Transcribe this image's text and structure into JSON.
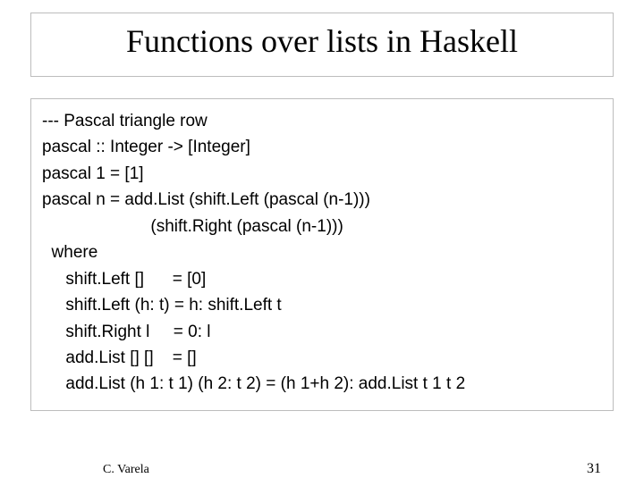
{
  "title": "Functions over lists in Haskell",
  "code": {
    "l1": "--- Pascal triangle row",
    "l2": "pascal :: Integer -> [Integer]",
    "l3": "pascal 1 = [1]",
    "l4": "pascal n = add.List (shift.Left (pascal (n-1)))",
    "l5": "                       (shift.Right (pascal (n-1)))",
    "l6": "  where",
    "l7": "     shift.Left []      = [0]",
    "l8": "     shift.Left (h: t) = h: shift.Left t",
    "l9": "     shift.Right l     = 0: l",
    "l10": "     add.List [] []    = []",
    "l11": "     add.List (h 1: t 1) (h 2: t 2) = (h 1+h 2): add.List t 1 t 2"
  },
  "footer": {
    "author": "C. Varela",
    "page": "31"
  }
}
